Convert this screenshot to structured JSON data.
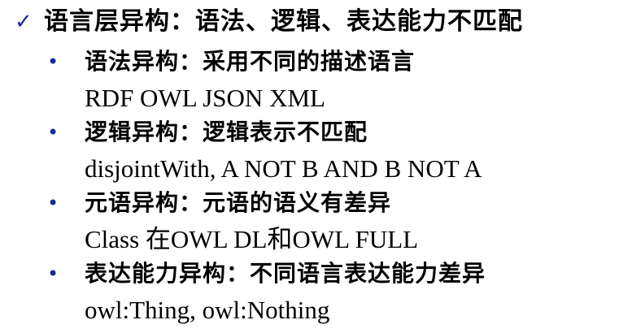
{
  "main": {
    "icon": "check-icon",
    "icon_color": "#1a2a99",
    "heading": "语言层异构：语法、逻辑、表达能力不匹配"
  },
  "items": [
    {
      "title": "语法异构：采用不同的描述语言",
      "detail": "RDF OWL JSON XML"
    },
    {
      "title": "逻辑异构：逻辑表示不匹配",
      "detail": "disjointWith, A NOT B AND B NOT A"
    },
    {
      "title": "元语异构：元语的语义有差异",
      "detail": "Class 在OWL DL和OWL FULL"
    },
    {
      "title": "表达能力异构：不同语言表达能力差异",
      "detail": "owl:Thing, owl:Nothing"
    }
  ],
  "bullet_icon": "bullet-dot-icon",
  "bullet_color": "#1a2a99"
}
